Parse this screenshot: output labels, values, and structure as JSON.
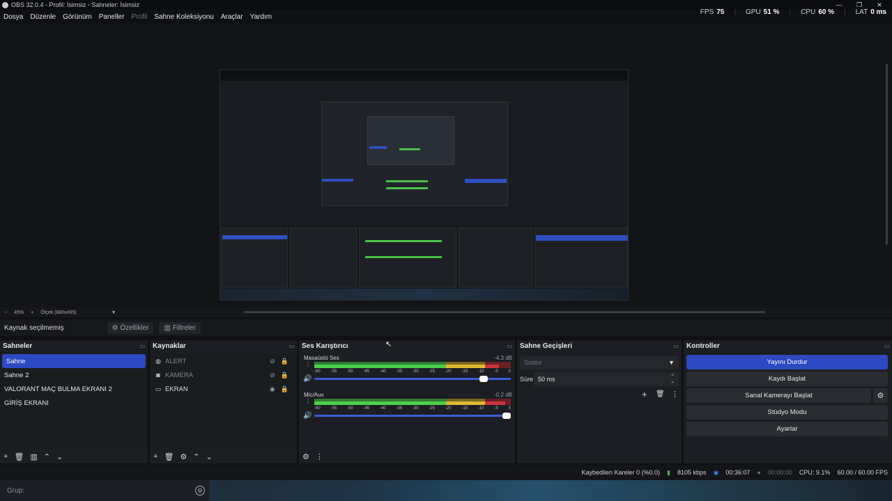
{
  "window": {
    "title": "OBS 32.0.4 - Profil: İsimsiz - Sahneler: İsimsiz",
    "min": "—",
    "max": "❐",
    "close": "✕"
  },
  "menu": [
    "Dosya",
    "Düzenle",
    "Görünüm",
    "Paneller",
    "Profil",
    "Sahne Koleksiyonu",
    "Araçlar",
    "Yardım"
  ],
  "stats": {
    "fps_label": "FPS",
    "fps": "75",
    "gpu_label": "GPU",
    "gpu": "51 %",
    "cpu_label": "CPU",
    "cpu": "60 %",
    "lat_label": "LAT",
    "lat": "0 ms"
  },
  "zoom": {
    "minus": "−",
    "value": "45%",
    "plus": "+",
    "scale": "Ölçek (880x495)"
  },
  "properties_bar": {
    "no_source": "Kaynak seçilmemiş",
    "properties": "Özellikler",
    "filters": "Filtreler"
  },
  "scenes": {
    "title": "Sahneler",
    "items": [
      "Sahne",
      "Sahne 2",
      "VALORANT MAÇ BULMA EKRANI 2",
      "GİRİŞ EKRANI"
    ]
  },
  "sources": {
    "title": "Kaynaklar",
    "items": [
      {
        "name": "ALERT",
        "icon": "globe-icon",
        "visible": false
      },
      {
        "name": "KAMERA",
        "icon": "camera-icon",
        "visible": false
      },
      {
        "name": "EKRAN",
        "icon": "monitor-icon",
        "visible": true
      }
    ]
  },
  "mixer": {
    "title": "Ses Karıştırıcı",
    "channels": [
      {
        "name": "Masaüstü Ses",
        "db": "-4.3 dB",
        "level": 0.94,
        "volume": 0.86
      },
      {
        "name": "Mic/Aux",
        "db": "-0.2 dB",
        "level": 0.97,
        "volume": 0.98
      }
    ],
    "ticks": [
      "-60",
      "-55",
      "-50",
      "-45",
      "-40",
      "-35",
      "-30",
      "-25",
      "-20",
      "-15",
      "-10",
      "-5",
      "0"
    ]
  },
  "transitions": {
    "title": "Sahne Geçişleri",
    "transition": "Soldur",
    "duration_label": "Süre",
    "duration": "50 ms"
  },
  "controls": {
    "title": "Kontroller",
    "stop_stream": "Yayını Durdur",
    "start_record": "Kaydı Başlat",
    "start_vcam": "Sanal Kamerayı Başlat",
    "studio": "Stüdyo Modu",
    "settings": "Ayarlar"
  },
  "status": {
    "dropped": "Kaybedilen Kareler 0 (%0.0)",
    "bitrate": "8105 kbps",
    "stream_time": "00:36:07",
    "rec_time": "00:00:00",
    "cpu": "CPU: 9.1%",
    "fps": "60.00 / 60.00 FPS"
  },
  "taskbar": {
    "search": "Grup:"
  }
}
